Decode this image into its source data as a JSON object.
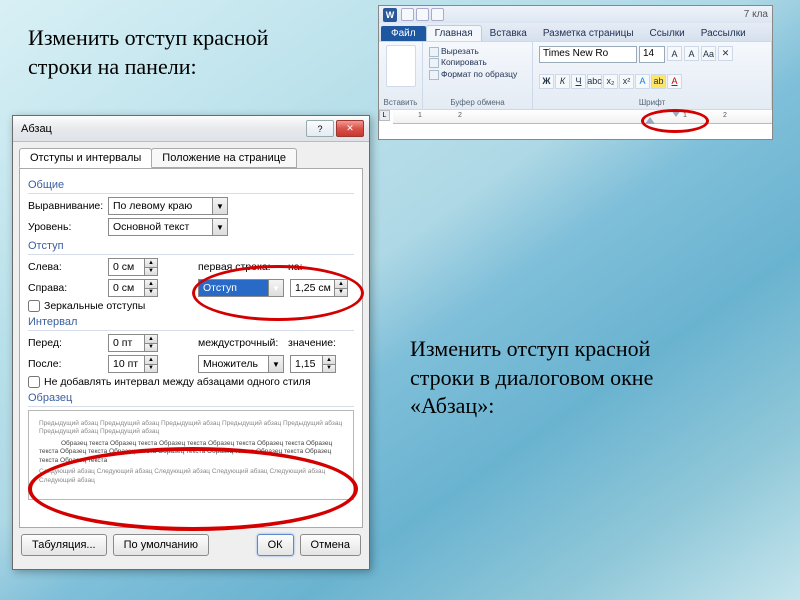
{
  "captions": {
    "top": "Изменить отступ красной строки на панели:",
    "bottom": "Изменить отступ красной строки в диалоговом окне «Абзац»:"
  },
  "ribbon": {
    "doc_title": "7 кла",
    "tabs": {
      "file": "Файл",
      "home": "Главная",
      "insert": "Вставка",
      "layout": "Разметка страницы",
      "refs": "Ссылки",
      "mail": "Рассылки"
    },
    "clipboard": {
      "paste": "Вставить",
      "cut": "Вырезать",
      "copy": "Копировать",
      "format_painter": "Формат по образцу",
      "group": "Буфер обмена"
    },
    "font": {
      "name": "Times New Ro",
      "size": "14",
      "group": "Шрифт"
    },
    "ruler_marks": [
      "1",
      "2",
      "1",
      "2"
    ]
  },
  "dialog": {
    "title": "Абзац",
    "tabs": {
      "indents": "Отступы и интервалы",
      "position": "Положение на странице"
    },
    "general": {
      "section": "Общие",
      "alignment_lbl": "Выравнивание:",
      "alignment": "По левому краю",
      "level_lbl": "Уровень:",
      "level": "Основной текст"
    },
    "indent": {
      "section": "Отступ",
      "left_lbl": "Слева:",
      "left": "0 см",
      "right_lbl": "Справа:",
      "right": "0 см",
      "special_lbl": "первая строка:",
      "special": "Отступ",
      "by_lbl": "на:",
      "by": "1,25 см",
      "mirror": "Зеркальные отступы"
    },
    "spacing": {
      "section": "Интервал",
      "before_lbl": "Перед:",
      "before": "0 пт",
      "after_lbl": "После:",
      "after": "10 пт",
      "line_lbl": "междустрочный:",
      "line": "Множитель",
      "at_lbl": "значение:",
      "at": "1,15",
      "nospace": "Не добавлять интервал между абзацами одного стиля"
    },
    "preview": {
      "section": "Образец",
      "sample": "Образец текста Образец текста Образец текста Образец текста Образец текста Образец текста Образец текста Образец текста Образец текста Образец текста Образец текста Образец текста Образец текста"
    },
    "buttons": {
      "tabs": "Табуляция...",
      "default": "По умолчанию",
      "ok": "ОК",
      "cancel": "Отмена"
    }
  }
}
